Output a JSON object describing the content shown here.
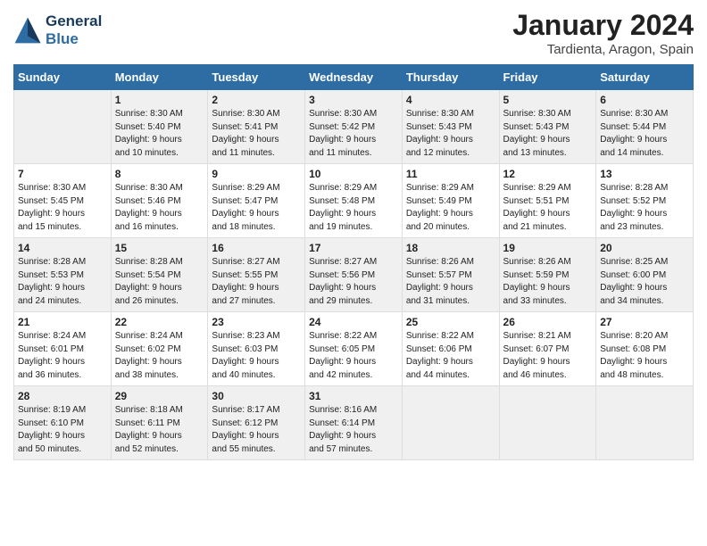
{
  "logo": {
    "line1": "General",
    "line2": "Blue"
  },
  "title": "January 2024",
  "subtitle": "Tardienta, Aragon, Spain",
  "days_of_week": [
    "Sunday",
    "Monday",
    "Tuesday",
    "Wednesday",
    "Thursday",
    "Friday",
    "Saturday"
  ],
  "weeks": [
    [
      {
        "num": "",
        "lines": []
      },
      {
        "num": "1",
        "lines": [
          "Sunrise: 8:30 AM",
          "Sunset: 5:40 PM",
          "Daylight: 9 hours",
          "and 10 minutes."
        ]
      },
      {
        "num": "2",
        "lines": [
          "Sunrise: 8:30 AM",
          "Sunset: 5:41 PM",
          "Daylight: 9 hours",
          "and 11 minutes."
        ]
      },
      {
        "num": "3",
        "lines": [
          "Sunrise: 8:30 AM",
          "Sunset: 5:42 PM",
          "Daylight: 9 hours",
          "and 11 minutes."
        ]
      },
      {
        "num": "4",
        "lines": [
          "Sunrise: 8:30 AM",
          "Sunset: 5:43 PM",
          "Daylight: 9 hours",
          "and 12 minutes."
        ]
      },
      {
        "num": "5",
        "lines": [
          "Sunrise: 8:30 AM",
          "Sunset: 5:43 PM",
          "Daylight: 9 hours",
          "and 13 minutes."
        ]
      },
      {
        "num": "6",
        "lines": [
          "Sunrise: 8:30 AM",
          "Sunset: 5:44 PM",
          "Daylight: 9 hours",
          "and 14 minutes."
        ]
      }
    ],
    [
      {
        "num": "7",
        "lines": [
          "Sunrise: 8:30 AM",
          "Sunset: 5:45 PM",
          "Daylight: 9 hours",
          "and 15 minutes."
        ]
      },
      {
        "num": "8",
        "lines": [
          "Sunrise: 8:30 AM",
          "Sunset: 5:46 PM",
          "Daylight: 9 hours",
          "and 16 minutes."
        ]
      },
      {
        "num": "9",
        "lines": [
          "Sunrise: 8:29 AM",
          "Sunset: 5:47 PM",
          "Daylight: 9 hours",
          "and 18 minutes."
        ]
      },
      {
        "num": "10",
        "lines": [
          "Sunrise: 8:29 AM",
          "Sunset: 5:48 PM",
          "Daylight: 9 hours",
          "and 19 minutes."
        ]
      },
      {
        "num": "11",
        "lines": [
          "Sunrise: 8:29 AM",
          "Sunset: 5:49 PM",
          "Daylight: 9 hours",
          "and 20 minutes."
        ]
      },
      {
        "num": "12",
        "lines": [
          "Sunrise: 8:29 AM",
          "Sunset: 5:51 PM",
          "Daylight: 9 hours",
          "and 21 minutes."
        ]
      },
      {
        "num": "13",
        "lines": [
          "Sunrise: 8:28 AM",
          "Sunset: 5:52 PM",
          "Daylight: 9 hours",
          "and 23 minutes."
        ]
      }
    ],
    [
      {
        "num": "14",
        "lines": [
          "Sunrise: 8:28 AM",
          "Sunset: 5:53 PM",
          "Daylight: 9 hours",
          "and 24 minutes."
        ]
      },
      {
        "num": "15",
        "lines": [
          "Sunrise: 8:28 AM",
          "Sunset: 5:54 PM",
          "Daylight: 9 hours",
          "and 26 minutes."
        ]
      },
      {
        "num": "16",
        "lines": [
          "Sunrise: 8:27 AM",
          "Sunset: 5:55 PM",
          "Daylight: 9 hours",
          "and 27 minutes."
        ]
      },
      {
        "num": "17",
        "lines": [
          "Sunrise: 8:27 AM",
          "Sunset: 5:56 PM",
          "Daylight: 9 hours",
          "and 29 minutes."
        ]
      },
      {
        "num": "18",
        "lines": [
          "Sunrise: 8:26 AM",
          "Sunset: 5:57 PM",
          "Daylight: 9 hours",
          "and 31 minutes."
        ]
      },
      {
        "num": "19",
        "lines": [
          "Sunrise: 8:26 AM",
          "Sunset: 5:59 PM",
          "Daylight: 9 hours",
          "and 33 minutes."
        ]
      },
      {
        "num": "20",
        "lines": [
          "Sunrise: 8:25 AM",
          "Sunset: 6:00 PM",
          "Daylight: 9 hours",
          "and 34 minutes."
        ]
      }
    ],
    [
      {
        "num": "21",
        "lines": [
          "Sunrise: 8:24 AM",
          "Sunset: 6:01 PM",
          "Daylight: 9 hours",
          "and 36 minutes."
        ]
      },
      {
        "num": "22",
        "lines": [
          "Sunrise: 8:24 AM",
          "Sunset: 6:02 PM",
          "Daylight: 9 hours",
          "and 38 minutes."
        ]
      },
      {
        "num": "23",
        "lines": [
          "Sunrise: 8:23 AM",
          "Sunset: 6:03 PM",
          "Daylight: 9 hours",
          "and 40 minutes."
        ]
      },
      {
        "num": "24",
        "lines": [
          "Sunrise: 8:22 AM",
          "Sunset: 6:05 PM",
          "Daylight: 9 hours",
          "and 42 minutes."
        ]
      },
      {
        "num": "25",
        "lines": [
          "Sunrise: 8:22 AM",
          "Sunset: 6:06 PM",
          "Daylight: 9 hours",
          "and 44 minutes."
        ]
      },
      {
        "num": "26",
        "lines": [
          "Sunrise: 8:21 AM",
          "Sunset: 6:07 PM",
          "Daylight: 9 hours",
          "and 46 minutes."
        ]
      },
      {
        "num": "27",
        "lines": [
          "Sunrise: 8:20 AM",
          "Sunset: 6:08 PM",
          "Daylight: 9 hours",
          "and 48 minutes."
        ]
      }
    ],
    [
      {
        "num": "28",
        "lines": [
          "Sunrise: 8:19 AM",
          "Sunset: 6:10 PM",
          "Daylight: 9 hours",
          "and 50 minutes."
        ]
      },
      {
        "num": "29",
        "lines": [
          "Sunrise: 8:18 AM",
          "Sunset: 6:11 PM",
          "Daylight: 9 hours",
          "and 52 minutes."
        ]
      },
      {
        "num": "30",
        "lines": [
          "Sunrise: 8:17 AM",
          "Sunset: 6:12 PM",
          "Daylight: 9 hours",
          "and 55 minutes."
        ]
      },
      {
        "num": "31",
        "lines": [
          "Sunrise: 8:16 AM",
          "Sunset: 6:14 PM",
          "Daylight: 9 hours",
          "and 57 minutes."
        ]
      },
      {
        "num": "",
        "lines": []
      },
      {
        "num": "",
        "lines": []
      },
      {
        "num": "",
        "lines": []
      }
    ]
  ]
}
